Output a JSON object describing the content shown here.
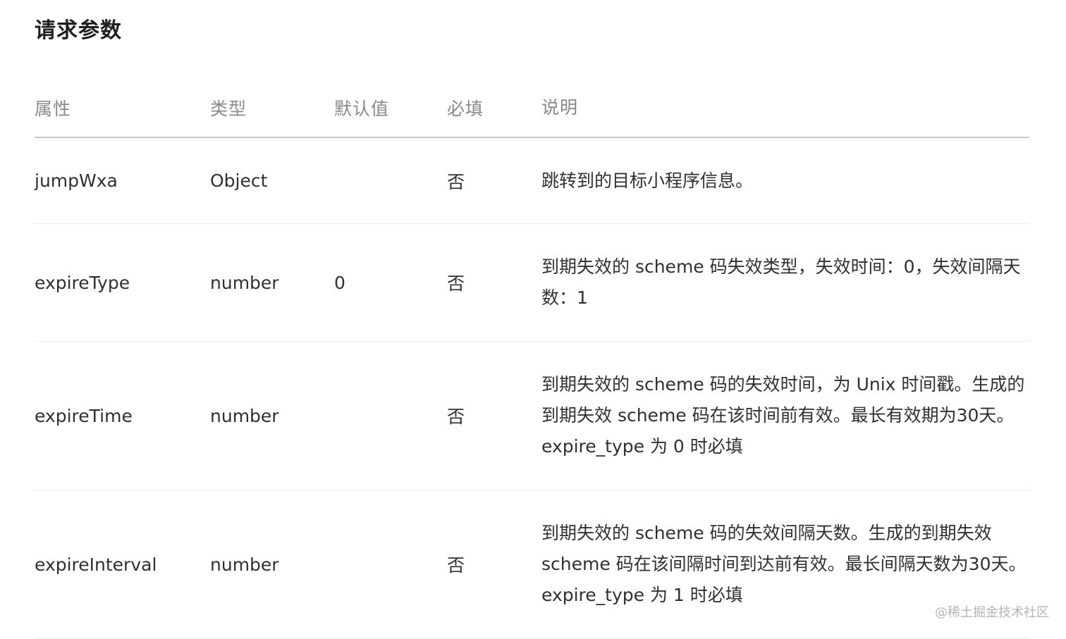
{
  "section": {
    "title": "请求参数"
  },
  "table": {
    "headers": {
      "attr": "属性",
      "type": "类型",
      "default": "默认值",
      "required": "必填",
      "desc": "说明"
    },
    "rows": [
      {
        "attr": "jumpWxa",
        "type": "Object",
        "default": "",
        "required": "否",
        "desc": "跳转到的目标小程序信息。"
      },
      {
        "attr": "expireType",
        "type": "number",
        "default": "0",
        "required": "否",
        "desc": "到期失效的 scheme 码失效类型，失效时间：0，失效间隔天数：1"
      },
      {
        "attr": "expireTime",
        "type": "number",
        "default": "",
        "required": "否",
        "desc": "到期失效的 scheme 码的失效时间，为 Unix 时间戳。生成的到期失效 scheme 码在该时间前有效。最长有效期为30天。expire_type 为 0 时必填"
      },
      {
        "attr": "expireInterval",
        "type": "number",
        "default": "",
        "required": "否",
        "desc": "到期失效的 scheme 码的失效间隔天数。生成的到期失效 scheme 码在该间隔时间到达前有效。最长间隔天数为30天。 expire_type 为 1 时必填"
      }
    ]
  },
  "watermark": {
    "text": "@稀土掘金技术社区"
  }
}
